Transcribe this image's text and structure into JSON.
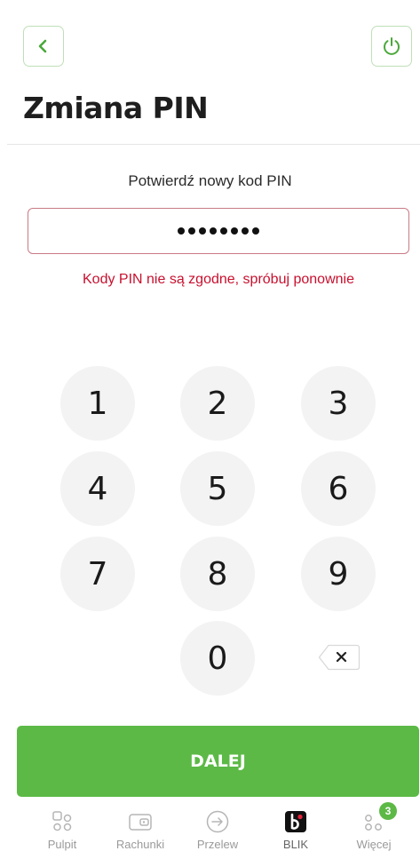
{
  "header": {
    "title": "Zmiana PIN",
    "back_icon": "chevron-left-icon",
    "power_icon": "power-icon",
    "accent_color": "#5cb946"
  },
  "pin": {
    "prompt": "Potwierdź nowy kod PIN",
    "masked_length": 8,
    "error": "Kody PIN nie są zgodne, spróbuj ponownie",
    "error_color": "#c8102e"
  },
  "keypad": {
    "keys": [
      "1",
      "2",
      "3",
      "4",
      "5",
      "6",
      "7",
      "8",
      "9",
      "0"
    ],
    "backspace_icon": "backspace-icon"
  },
  "footer": {
    "continue_label": "DALEJ"
  },
  "tabbar": {
    "items": [
      {
        "label": "Pulpit",
        "icon": "dashboard-icon"
      },
      {
        "label": "Rachunki",
        "icon": "wallet-icon"
      },
      {
        "label": "Przelew",
        "icon": "transfer-icon"
      },
      {
        "label": "BLIK",
        "icon": "blik-icon"
      },
      {
        "label": "Więcej",
        "icon": "more-icon",
        "badge": "3"
      }
    ]
  }
}
